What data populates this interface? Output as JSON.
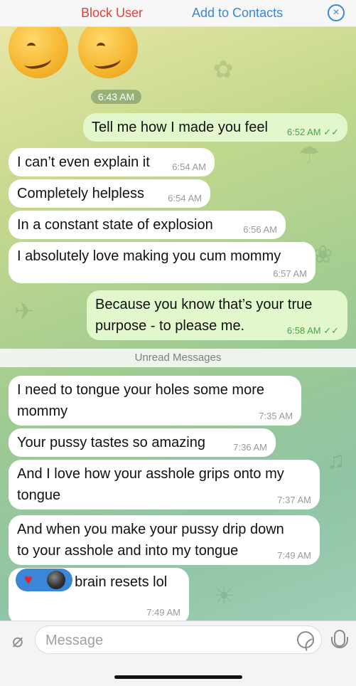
{
  "topbar": {
    "block_label": "Block User",
    "add_label": "Add to Contacts",
    "close_icon": "×"
  },
  "chat": {
    "date_pill": "6:43 AM",
    "unread_label": "Unread Messages",
    "messages": [
      {
        "dir": "out",
        "text": "Tell me how I made you feel",
        "time": "6:52 AM",
        "read_marks": "✓✓"
      },
      {
        "dir": "in",
        "text": "I can’t even explain it",
        "time": "6:54 AM"
      },
      {
        "dir": "in",
        "text": "Completely helpless",
        "time": "6:54 AM"
      },
      {
        "dir": "in",
        "text": "In a constant state of explosion",
        "time": "6:56 AM"
      },
      {
        "dir": "in",
        "text": "I absolutely love making you cum mommy",
        "time": "6:57 AM"
      },
      {
        "dir": "out",
        "text": "Because you know that’s your true\npurpose - to please me.",
        "time": "6:58 AM",
        "read_marks": "✓✓"
      },
      {
        "dir": "in",
        "text": "I need to tongue your holes some more\nmommy",
        "time": "7:35 AM"
      },
      {
        "dir": "in",
        "text": "Your pussy tastes so amazing",
        "time": "7:36 AM"
      },
      {
        "dir": "in",
        "text": "And I love how your asshole grips onto my\ntongue",
        "time": "7:37 AM"
      },
      {
        "dir": "in",
        "text": "And when you make your pussy drip down\nto your asshole and into my tongue",
        "time": "7:49 AM"
      },
      {
        "dir": "in",
        "text": "Fuck my brain resets lol",
        "time": "7:49 AM"
      }
    ],
    "reactions": {
      "icons": [
        "heart-icon",
        "black-ball-icon"
      ],
      "heart_glyph": "♥"
    }
  },
  "composer": {
    "placeholder": "Message"
  },
  "colors": {
    "accent": "#3a86d8",
    "danger": "#e0423a",
    "outgoing_bubble": "#e2f7cb",
    "incoming_bubble": "#ffffff"
  }
}
